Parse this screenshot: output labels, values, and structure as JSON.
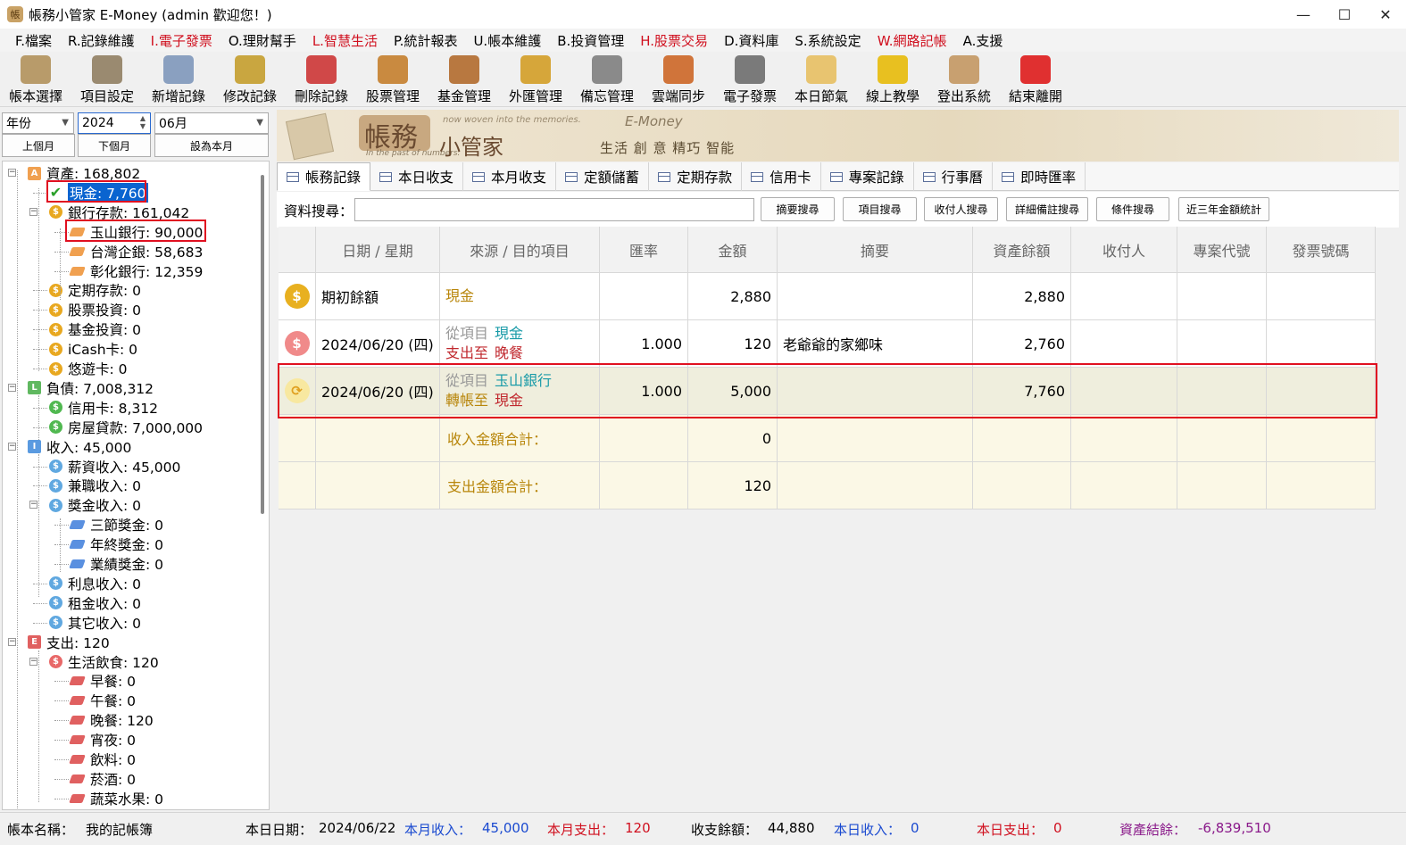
{
  "window": {
    "title": "帳務小管家 E-Money (admin 歡迎您！)",
    "min": "—",
    "max": "☐",
    "close": "✕"
  },
  "menu": [
    {
      "label": "F.檔案",
      "red": false
    },
    {
      "label": "R.記錄維護",
      "red": false
    },
    {
      "label": "I.電子發票",
      "red": true
    },
    {
      "label": "O.理財幫手",
      "red": false
    },
    {
      "label": "L.智慧生活",
      "red": true
    },
    {
      "label": "P.統計報表",
      "red": false
    },
    {
      "label": "U.帳本維護",
      "red": false
    },
    {
      "label": "B.投資管理",
      "red": false
    },
    {
      "label": "H.股票交易",
      "red": true
    },
    {
      "label": "D.資料庫",
      "red": false
    },
    {
      "label": "S.系統設定",
      "red": false
    },
    {
      "label": "W.網路記帳",
      "red": true
    },
    {
      "label": "A.支援",
      "red": false
    }
  ],
  "toolbar": [
    {
      "label": "帳本選擇",
      "icon": "ledger-icon",
      "color": "#b89b6a"
    },
    {
      "label": "項目設定",
      "icon": "gear-icon",
      "color": "#9a8a70"
    },
    {
      "label": "新增記錄",
      "icon": "add-record-icon",
      "color": "#8aa0c0"
    },
    {
      "label": "修改記錄",
      "icon": "edit-record-icon",
      "color": "#c9a640"
    },
    {
      "label": "刪除記錄",
      "icon": "delete-record-icon",
      "color": "#d04848"
    },
    {
      "label": "股票管理",
      "icon": "stock-icon",
      "color": "#c98a40"
    },
    {
      "label": "基金管理",
      "icon": "fund-icon",
      "color": "#b87840"
    },
    {
      "label": "外匯管理",
      "icon": "forex-icon",
      "color": "#d6a63a"
    },
    {
      "label": "備忘管理",
      "icon": "memo-icon",
      "color": "#8a8a8a"
    },
    {
      "label": "雲端同步",
      "icon": "cloud-sync-icon",
      "color": "#d0743a"
    },
    {
      "label": "電子發票",
      "icon": "qrcode-icon",
      "color": "#7a7a7a"
    },
    {
      "label": "本日節氣",
      "icon": "solar-term-icon",
      "color": "#e8c470"
    },
    {
      "label": "線上教學",
      "icon": "help-icon",
      "color": "#e8c020"
    },
    {
      "label": "登出系統",
      "icon": "logout-icon",
      "color": "#c8a070"
    },
    {
      "label": "結束離開",
      "icon": "exit-icon",
      "color": "#e03030"
    }
  ],
  "filter": {
    "period": "年份",
    "year": "2024",
    "month": "06月",
    "prev": "上個月",
    "next": "下個月",
    "current": "設為本月"
  },
  "tree": [
    {
      "label": "資產: 168,802",
      "level": 0,
      "icon": "A",
      "color": "#f0a050",
      "expander": "−"
    },
    {
      "label": "現金: 7,760",
      "level": 1,
      "icon": "check",
      "color": "#2aa02a",
      "selected": true
    },
    {
      "label": "銀行存款: 161,042",
      "level": 1,
      "icon": "$",
      "color": "#e8a820",
      "expander": "−"
    },
    {
      "label": "玉山銀行: 90,000",
      "level": 2,
      "icon": "gem",
      "color": "#f0a050"
    },
    {
      "label": "台灣企銀: 58,683",
      "level": 2,
      "icon": "gem",
      "color": "#f0a050"
    },
    {
      "label": "彰化銀行: 12,359",
      "level": 2,
      "icon": "gem",
      "color": "#f0a050"
    },
    {
      "label": "定期存款: 0",
      "level": 1,
      "icon": "$",
      "color": "#e8a820"
    },
    {
      "label": "股票投資: 0",
      "level": 1,
      "icon": "$",
      "color": "#e8a820"
    },
    {
      "label": "基金投資: 0",
      "level": 1,
      "icon": "$",
      "color": "#e8a820"
    },
    {
      "label": "iCash卡: 0",
      "level": 1,
      "icon": "$",
      "color": "#e8a820"
    },
    {
      "label": "悠遊卡: 0",
      "level": 1,
      "icon": "$",
      "color": "#e8a820"
    },
    {
      "label": "負債: 7,008,312",
      "level": 0,
      "icon": "L",
      "color": "#60b860",
      "expander": "−"
    },
    {
      "label": "信用卡: 8,312",
      "level": 1,
      "icon": "$",
      "color": "#50b850"
    },
    {
      "label": "房屋貸款: 7,000,000",
      "level": 1,
      "icon": "$",
      "color": "#50b850"
    },
    {
      "label": "收入: 45,000",
      "level": 0,
      "icon": "I",
      "color": "#5a9ae0",
      "expander": "−"
    },
    {
      "label": "薪資收入: 45,000",
      "level": 1,
      "icon": "$",
      "color": "#60a8e0"
    },
    {
      "label": "兼職收入: 0",
      "level": 1,
      "icon": "$",
      "color": "#60a8e0"
    },
    {
      "label": "獎金收入: 0",
      "level": 1,
      "icon": "$",
      "color": "#60a8e0",
      "expander": "−"
    },
    {
      "label": "三節獎金: 0",
      "level": 2,
      "icon": "gem",
      "color": "#5a90e0"
    },
    {
      "label": "年終獎金: 0",
      "level": 2,
      "icon": "gem",
      "color": "#5a90e0"
    },
    {
      "label": "業績獎金: 0",
      "level": 2,
      "icon": "gem",
      "color": "#5a90e0"
    },
    {
      "label": "利息收入: 0",
      "level": 1,
      "icon": "$",
      "color": "#60a8e0"
    },
    {
      "label": "租金收入: 0",
      "level": 1,
      "icon": "$",
      "color": "#60a8e0"
    },
    {
      "label": "其它收入: 0",
      "level": 1,
      "icon": "$",
      "color": "#60a8e0"
    },
    {
      "label": "支出: 120",
      "level": 0,
      "icon": "E",
      "color": "#e06060",
      "expander": "−"
    },
    {
      "label": "生活飲食: 120",
      "level": 1,
      "icon": "$",
      "color": "#e86868",
      "expander": "−"
    },
    {
      "label": "早餐: 0",
      "level": 2,
      "icon": "gem",
      "color": "#e06060"
    },
    {
      "label": "午餐: 0",
      "level": 2,
      "icon": "gem",
      "color": "#e06060"
    },
    {
      "label": "晚餐: 120",
      "level": 2,
      "icon": "gem",
      "color": "#e06060"
    },
    {
      "label": "宵夜: 0",
      "level": 2,
      "icon": "gem",
      "color": "#e06060"
    },
    {
      "label": "飲料: 0",
      "level": 2,
      "icon": "gem",
      "color": "#e06060"
    },
    {
      "label": "菸酒: 0",
      "level": 2,
      "icon": "gem",
      "color": "#e06060"
    },
    {
      "label": "蔬菜水果: 0",
      "level": 2,
      "icon": "gem",
      "color": "#e06060"
    }
  ],
  "banner": {
    "big": "帳務",
    "small": "小管家",
    "tagline1": "now woven into the memories.",
    "tagline2": "In the past of numbers.",
    "brand": "E-Money",
    "slogan": "生活 創 意 精巧 智能"
  },
  "tabs": [
    "帳務記錄",
    "本日收支",
    "本月收支",
    "定額儲蓄",
    "定期存款",
    "信用卡",
    "專案記錄",
    "行事曆",
    "即時匯率"
  ],
  "search": {
    "label": "資料搜尋：",
    "value": "",
    "buttons": [
      "摘要搜尋",
      "項目搜尋",
      "收付人搜尋",
      "詳細備註搜尋",
      "條件搜尋",
      "近三年金額統計"
    ]
  },
  "grid": {
    "headers": [
      "",
      "日期 / 星期",
      "來源 / 目的項目",
      "匯率",
      "金額",
      "摘要",
      "資產餘額",
      "收付人",
      "專案代號",
      "發票號碼"
    ],
    "rows": [
      {
        "icon": "money-bag-icon",
        "date": "期初餘額",
        "line1_label": "",
        "line1_value": "現金",
        "line2_label": "",
        "line2_value": "",
        "rate": "",
        "amount": "2,880",
        "summary": "",
        "balance": "2,880"
      },
      {
        "icon": "expense-icon",
        "date": "2024/06/20 (四)",
        "line1_label": "從項目",
        "line1_value": "現金",
        "line2_label": "支出至",
        "line2_value": "晚餐",
        "rate": "1.000",
        "amount": "120",
        "summary": "老爺爺的家鄉味",
        "balance": "2,760"
      },
      {
        "icon": "transfer-icon",
        "date": "2024/06/20 (四)",
        "line1_label": "從項目",
        "line1_value": "玉山銀行",
        "line2_label": "轉帳至",
        "line2_value": "現金",
        "rate": "1.000",
        "amount": "5,000",
        "summary": "",
        "balance": "7,760"
      }
    ],
    "totals": [
      {
        "label": "收入金額合計：",
        "value": "0"
      },
      {
        "label": "支出金額合計：",
        "value": "120"
      }
    ]
  },
  "status": {
    "ledger_label": "帳本名稱：",
    "ledger": "我的記帳簿",
    "date_label": "本日日期：",
    "date": "2024/06/22",
    "month_income_label": "本月收入：",
    "month_income": "45,000",
    "month_expense_label": "本月支出：",
    "month_expense": "120",
    "balance_label": "收支餘額：",
    "balance": "44,880",
    "day_income_label": "本日收入：",
    "day_income": "0",
    "day_expense_label": "本日支出：",
    "day_expense": "0",
    "net_label": "資產結餘：",
    "net": "-6,839,510"
  }
}
